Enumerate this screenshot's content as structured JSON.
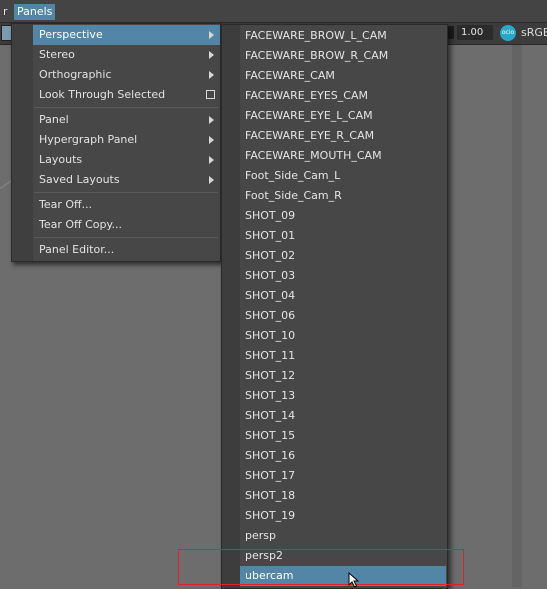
{
  "menubar": {
    "items": [
      {
        "id": "prev",
        "label": "r"
      },
      {
        "id": "panels",
        "label": "Panels"
      }
    ]
  },
  "toolbar": {
    "field_value": "1.00",
    "colorspace_badge": "ocio",
    "colorspace": "sRGB"
  },
  "panels_menu": {
    "items": [
      {
        "label": "Perspective",
        "submenu": true,
        "active": true
      },
      {
        "label": "Stereo",
        "submenu": true
      },
      {
        "label": "Orthographic",
        "submenu": true
      },
      {
        "label": "Look Through Selected",
        "checkbox": true
      },
      {
        "label": "Panel",
        "submenu": true
      },
      {
        "label": "Hypergraph Panel",
        "submenu": true
      },
      {
        "label": "Layouts",
        "submenu": true
      },
      {
        "label": "Saved Layouts",
        "submenu": true
      },
      {
        "label": "Tear Off..."
      },
      {
        "label": "Tear Off Copy..."
      },
      {
        "label": "Panel Editor..."
      }
    ]
  },
  "perspective_menu": {
    "items": [
      "FACEWARE_BROW_L_CAM",
      "FACEWARE_BROW_R_CAM",
      "FACEWARE_CAM",
      "FACEWARE_EYES_CAM",
      "FACEWARE_EYE_L_CAM",
      "FACEWARE_EYE_R_CAM",
      "FACEWARE_MOUTH_CAM",
      "Foot_Side_Cam_L",
      "Foot_Side_Cam_R",
      "SHOT_09",
      "SHOT_01",
      "SHOT_02",
      "SHOT_03",
      "SHOT_04",
      "SHOT_06",
      "SHOT_10",
      "SHOT_11",
      "SHOT_12",
      "SHOT_13",
      "SHOT_14",
      "SHOT_15",
      "SHOT_16",
      "SHOT_17",
      "SHOT_18",
      "SHOT_19",
      "persp",
      "persp2",
      "ubercam"
    ],
    "active_label": "ubercam"
  },
  "colors": {
    "accent": "#5285a6",
    "annotation": "#e0202a"
  }
}
